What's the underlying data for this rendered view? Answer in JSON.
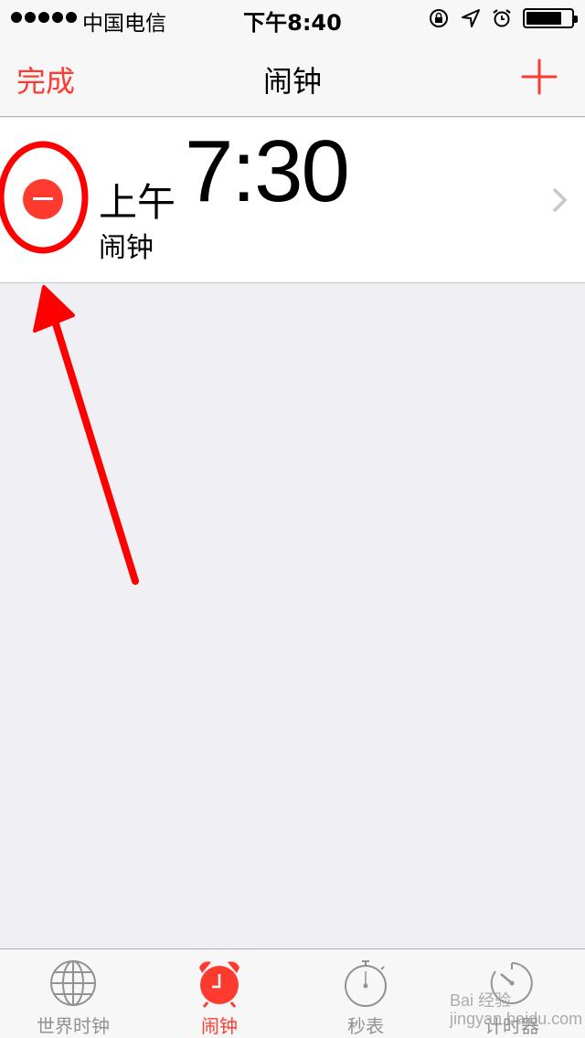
{
  "status_bar": {
    "signal_dots": 5,
    "carrier": "中国电信",
    "time": "下午8:40",
    "icons": [
      "orientation-lock-icon",
      "location-arrow-icon",
      "alarm-icon",
      "battery-icon"
    ],
    "battery_level": 0.8
  },
  "nav": {
    "done_label": "完成",
    "title": "闹钟",
    "add_icon": "plus-icon"
  },
  "alarm": {
    "ampm": "上午",
    "time": "7:30",
    "label": "闹钟"
  },
  "tabs": [
    {
      "label": "世界时钟",
      "icon": "globe-icon",
      "active": false
    },
    {
      "label": "闹钟",
      "icon": "alarm-clock-icon",
      "active": true
    },
    {
      "label": "秒表",
      "icon": "stopwatch-icon",
      "active": false
    },
    {
      "label": "计时器",
      "icon": "timer-icon",
      "active": false
    }
  ],
  "watermark": "Bai 经验\njingyan.baidu.com",
  "colors": {
    "accent": "#ff3b30",
    "annotation": "#ff0000",
    "background": "#efeff4",
    "bar": "#f7f7f7",
    "tab_inactive": "#929292"
  }
}
